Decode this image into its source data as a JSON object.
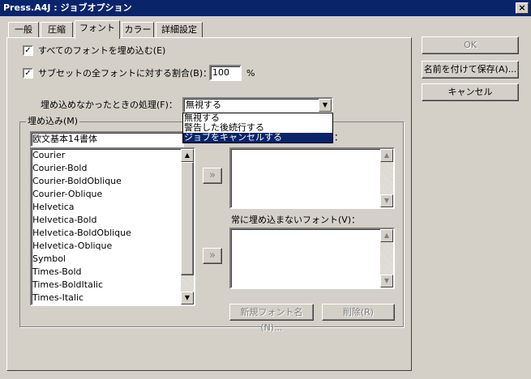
{
  "window": {
    "title": "Press.A4J : ジョブオプション",
    "close": "×"
  },
  "tabs": [
    {
      "label": "一般"
    },
    {
      "label": "圧縮"
    },
    {
      "label": "フォント"
    },
    {
      "label": "カラー"
    },
    {
      "label": "詳細設定"
    }
  ],
  "side_buttons": {
    "ok": "OK",
    "save_as": "名前を付けて保存(A)...",
    "cancel": "キャンセル"
  },
  "options": {
    "embed_all": {
      "label": "すべてのフォントを埋め込む(E)",
      "checked": true,
      "mark": "✓"
    },
    "subset": {
      "label": "サブセットの全フォントに対する割合(B)：",
      "checked": true,
      "mark": "✓",
      "value": "100",
      "unit": "%"
    }
  },
  "embed_fail": {
    "label": "埋め込めなかったときの処理(F)：",
    "selected": "無視する",
    "options": [
      "無視する",
      "警告した後続行する",
      "ジョブをキャンセルする"
    ]
  },
  "embed_group": {
    "legend": "埋め込み(M)",
    "font_set": "欧文基本14書体",
    "fonts": [
      "Courier",
      "Courier-Bold",
      "Courier-BoldOblique",
      "Courier-Oblique",
      "Helvetica",
      "Helvetica-Bold",
      "Helvetica-BoldOblique",
      "Helvetica-Oblique",
      "Symbol",
      "Times-Bold",
      "Times-BoldItalic",
      "Times-Italic"
    ],
    "always_embed_label_tail": "：",
    "never_embed_label": "常に埋め込まないフォント(V)：",
    "move_button": "»",
    "new_font_button": "新規フォント名(N)...",
    "delete_button": "削除(R)"
  },
  "scroll_icons": {
    "up": "▲",
    "down": "▼",
    "dropdown": "▼"
  }
}
